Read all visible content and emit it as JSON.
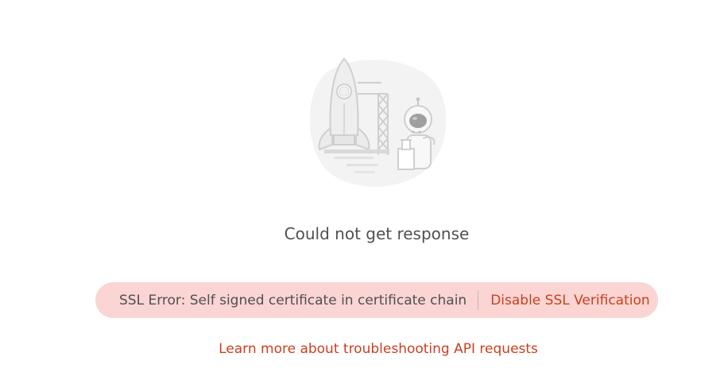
{
  "response": {
    "title": "Could not get response",
    "illustration_icon": "rocket-launch-astronaut-icon"
  },
  "ssl_error": {
    "message": "SSL Error: Self signed certificate in certificate chain",
    "action_label": "Disable SSL Verification"
  },
  "help": {
    "link_label": "Learn more about troubleshooting API requests"
  },
  "colors": {
    "banner_background": "#fad5d3",
    "accent": "#c9401f",
    "text": "#505050"
  }
}
